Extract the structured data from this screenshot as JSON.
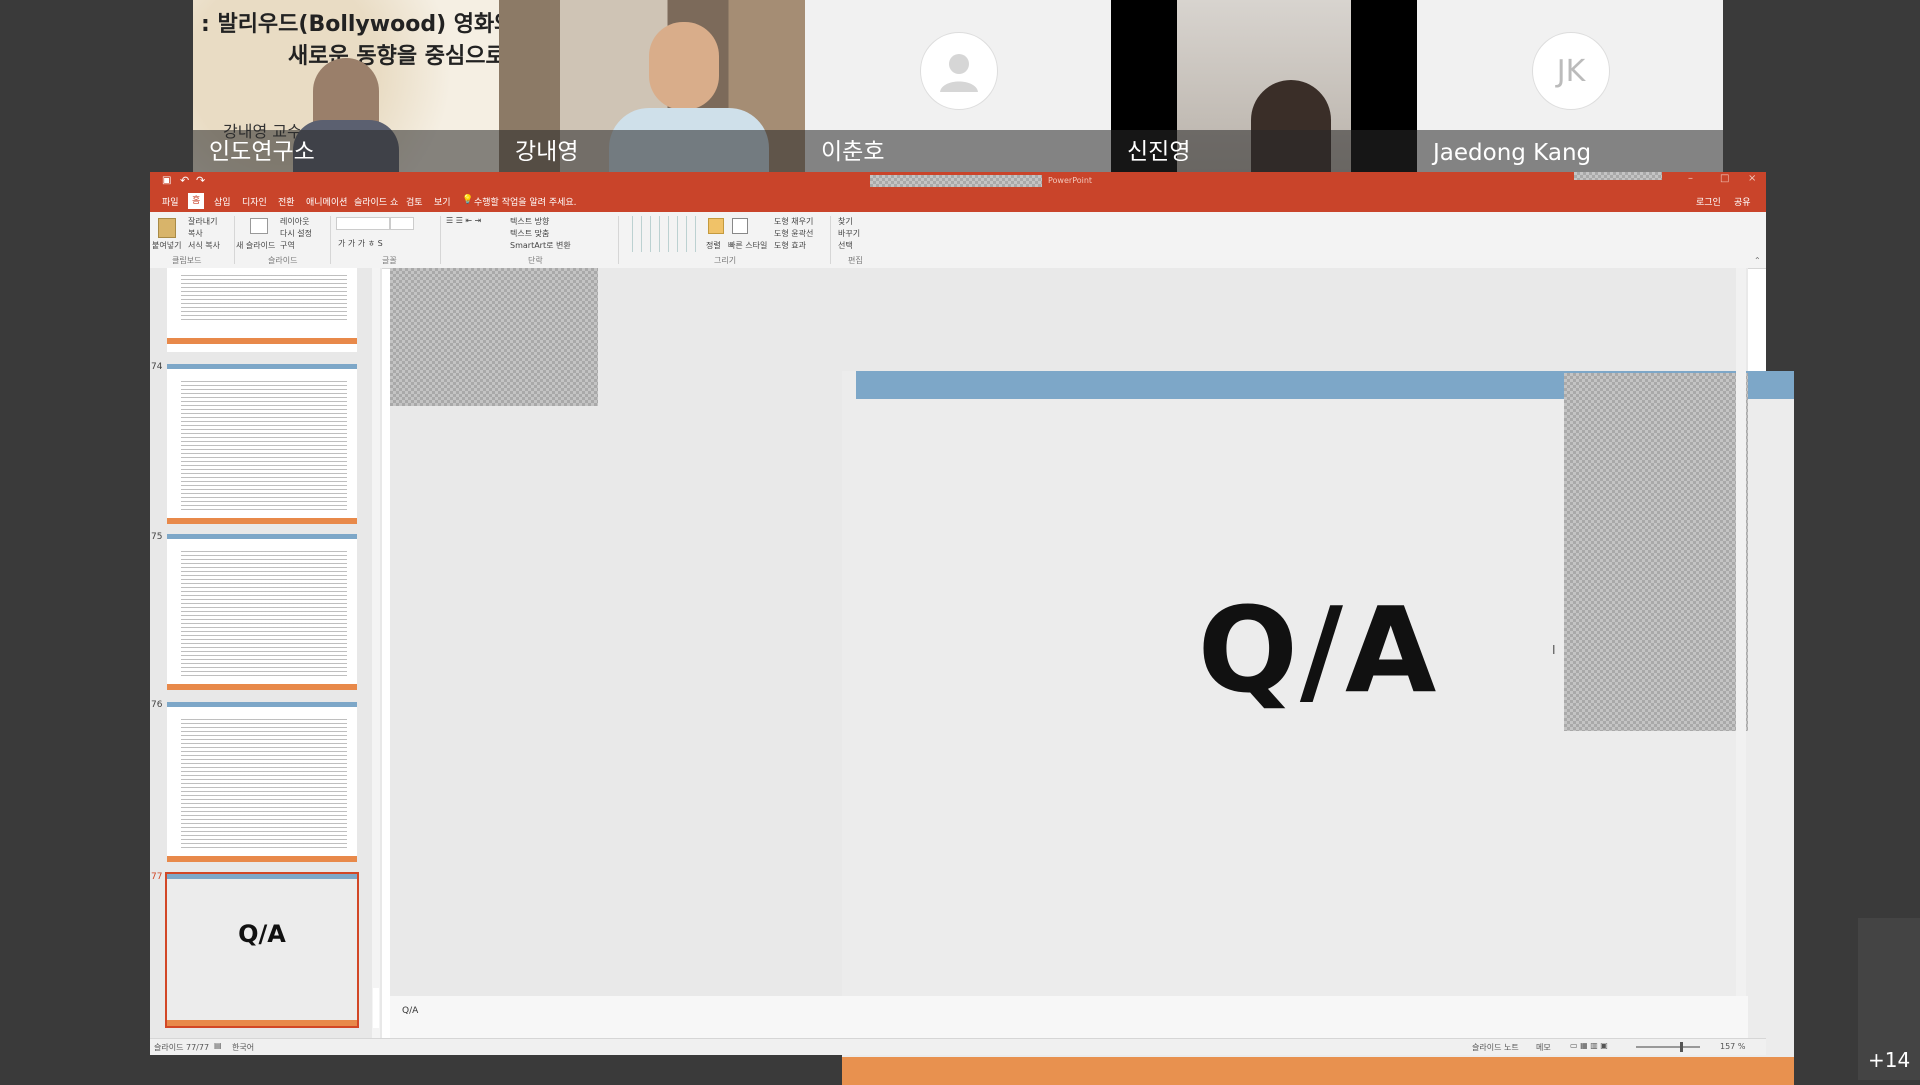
{
  "participants": [
    {
      "name": "인도연구소",
      "banner_line1": ": 발리우드(Bollywood) 영화와",
      "banner_line2": "새로운 동향을 중심으로",
      "banner_line3": "강내영 교수"
    },
    {
      "name": "강내영"
    },
    {
      "name": "이춘호"
    },
    {
      "name": "신진영"
    },
    {
      "name": "Jaedong Kang",
      "initials": "JK"
    }
  ],
  "more_participants": "+14",
  "ppt": {
    "app_name": "PowerPoint",
    "tabs": [
      "파일",
      "홈",
      "삽입",
      "디자인",
      "전환",
      "애니메이션",
      "슬라이드 쇼",
      "검토",
      "보기"
    ],
    "tell_me": "수행할 작업을 알려 주세요.",
    "signin": "로그인",
    "share": "공유",
    "ribbon": {
      "paste": "붙여넣기",
      "cut": "잘라내기",
      "copy": "복사",
      "format_painter": "서식 복사",
      "new_slide": "새 슬라이드",
      "layout": "레이아웃",
      "reset": "다시 설정",
      "section": "구역",
      "text_direction": "텍스트 방향",
      "align_text": "텍스트 맞춤",
      "smartart": "SmartArt로 변환",
      "arrange": "정렬",
      "quick_styles": "빠른 스타일",
      "shape_fill": "도형 채우기",
      "shape_outline": "도형 윤곽선",
      "shape_effects": "도형 효과",
      "find": "찾기",
      "replace": "바꾸기",
      "select": "선택",
      "groups": [
        "클립보드",
        "슬라이드",
        "글꼴",
        "단락",
        "그리기",
        "편집"
      ]
    },
    "thumbnails": [
      {
        "num": "74"
      },
      {
        "num": "75"
      },
      {
        "num": "76"
      },
      {
        "num": "77",
        "title": "Q/A"
      }
    ],
    "slide_title": "Q/A",
    "notes_text": "Q/A",
    "status": {
      "slide_info": "슬라이드 77/77",
      "language": "한국어",
      "notes_btn": "슬라이드 노트",
      "comments_btn": "메모",
      "zoom": "157 %"
    }
  }
}
